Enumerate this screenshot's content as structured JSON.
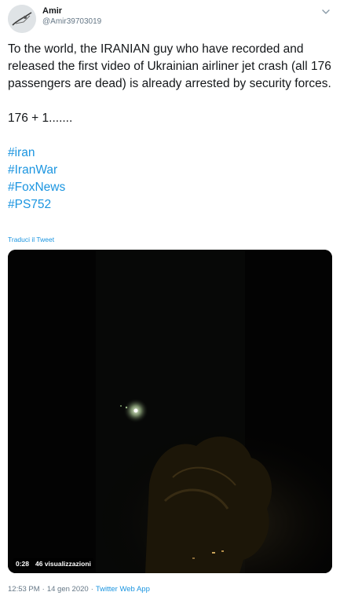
{
  "user": {
    "name": "Amir",
    "handle": "@Amir39703019"
  },
  "tweet": {
    "text": "To the world, the IRANIAN guy who have recorded and released the first video of Ukrainian airliner jet crash (all 176 passengers are dead) is already arrested by security forces.",
    "count_line": "176 + 1.......",
    "hashtags": [
      "#iran",
      "#IranWar",
      "#FoxNews",
      "#PS752"
    ],
    "translate_label": "Traduci il Tweet"
  },
  "video": {
    "duration": "0:28",
    "views": "46 visualizzazioni"
  },
  "meta": {
    "time": "12:53 PM",
    "separator": "·",
    "date": "14 gen 2020",
    "source": "Twitter Web App"
  },
  "colors": {
    "link": "#1b95e0",
    "secondary": "#657786",
    "text": "#14171a"
  },
  "icons": [
    "chevron-down-icon",
    "avatar"
  ]
}
